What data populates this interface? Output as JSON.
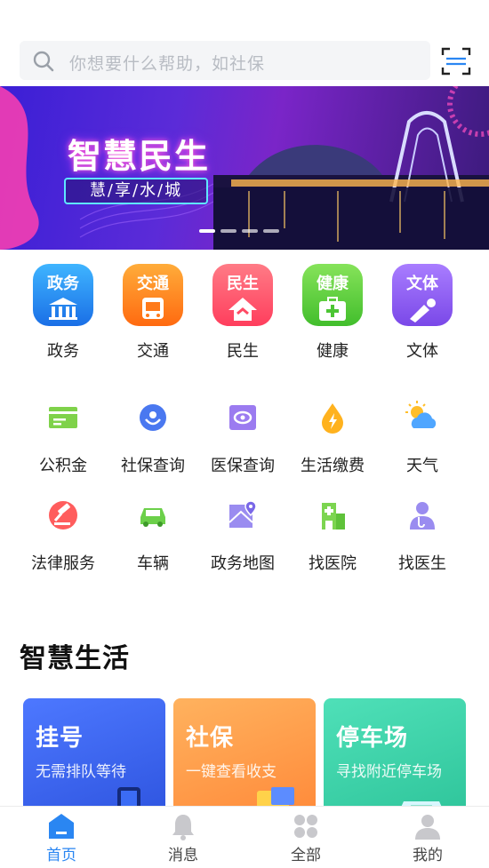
{
  "search": {
    "placeholder": "你想要什么帮助，如社保"
  },
  "banner": {
    "title": "智慧民生",
    "subtitle": "慧/享/水/城",
    "slide_count": 4,
    "active_slide": 1
  },
  "categories": [
    {
      "tile_text": "政务",
      "label": "政务",
      "color": "#1a8ff2"
    },
    {
      "tile_text": "交通",
      "label": "交通",
      "color": "#ff8a1c"
    },
    {
      "tile_text": "民生",
      "label": "民生",
      "color": "#ff5a6e"
    },
    {
      "tile_text": "健康",
      "label": "健康",
      "color": "#5fcf3e"
    },
    {
      "tile_text": "文体",
      "label": "文体",
      "color": "#8a5cf0"
    }
  ],
  "services": [
    {
      "label": "公积金",
      "icon": "housing-fund-icon"
    },
    {
      "label": "社保查询",
      "icon": "social-security-icon"
    },
    {
      "label": "医保查询",
      "icon": "medical-insurance-icon"
    },
    {
      "label": "生活缴费",
      "icon": "utility-payment-icon"
    },
    {
      "label": "天气",
      "icon": "weather-icon"
    },
    {
      "label": "法律服务",
      "icon": "gavel-icon"
    },
    {
      "label": "车辆",
      "icon": "car-icon"
    },
    {
      "label": "政务地图",
      "icon": "map-icon"
    },
    {
      "label": "找医院",
      "icon": "hospital-icon"
    },
    {
      "label": "找医生",
      "icon": "doctor-icon"
    }
  ],
  "smart_life": {
    "title": "智慧生活",
    "cards": [
      {
        "title": "挂号",
        "subtitle": "无需排队等待",
        "color": "#3d6ef0"
      },
      {
        "title": "社保",
        "subtitle": "一键查看收支",
        "color": "#ff9d4a"
      },
      {
        "title": "停车场",
        "subtitle": "寻找附近停车场",
        "color": "#3ed1a8"
      }
    ]
  },
  "tabbar": {
    "tabs": [
      {
        "label": "首页",
        "icon": "home-icon",
        "active": true
      },
      {
        "label": "消息",
        "icon": "bell-icon",
        "active": false
      },
      {
        "label": "全部",
        "icon": "grid-icon",
        "active": false
      },
      {
        "label": "我的",
        "icon": "user-icon",
        "active": false
      }
    ],
    "active_color": "#2a86f2"
  }
}
